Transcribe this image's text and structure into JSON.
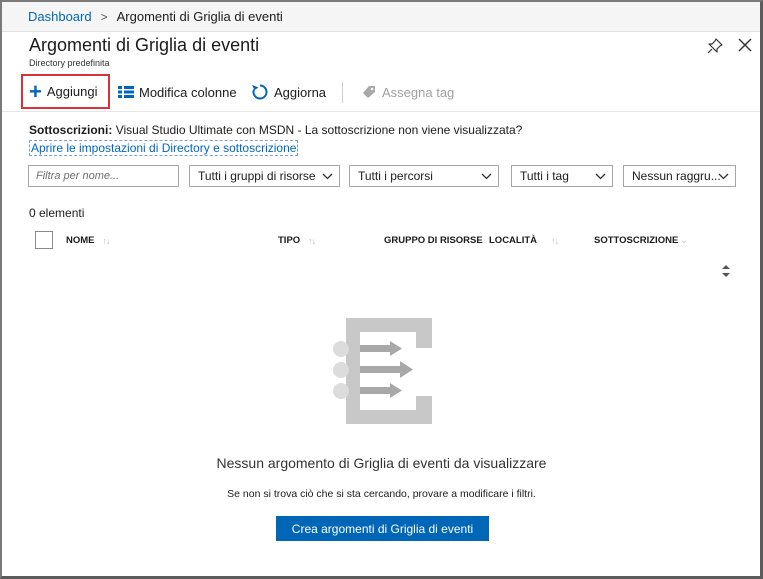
{
  "breadcrumb": {
    "home": "Dashboard",
    "current": "Argomenti di Griglia di eventi"
  },
  "header": {
    "title": "Argomenti di Griglia di eventi",
    "subtitle": "Directory predefinita"
  },
  "toolbar": {
    "add_label": "Aggiungi",
    "edit_columns_label": "Modifica colonne",
    "refresh_label": "Aggiorna",
    "assign_tags_label": "Assegna tag"
  },
  "subscriptions": {
    "label": "Sottoscrizioni:",
    "text": "Visual Studio Ultimate con MSDN - La sottoscrizione non viene visualizzata?",
    "link": "Aprire le impostazioni di Directory e sottoscrizione"
  },
  "filters": {
    "name_placeholder": "Filtra per nome...",
    "resource_groups": "Tutti i gruppi di risorse",
    "locations": "Tutti i percorsi",
    "tags": "Tutti i tag",
    "grouping": "Nessun raggru..."
  },
  "list": {
    "count": "0 elementi",
    "columns": {
      "name": "NOME",
      "type": "TIPO",
      "resource_group": "GRUPPO DI RISORSE",
      "location": "LOCALITÀ",
      "subscription": "SOTTOSCRIZIONE"
    }
  },
  "empty": {
    "message": "Nessun argomento di Griglia di eventi da visualizzare",
    "hint": "Se non si trova ciò che si sta cercando, provare a modificare i filtri.",
    "create_label": "Crea argomenti di Griglia di eventi"
  },
  "colors": {
    "accent": "#0067b8",
    "highlight_border": "#d9333a",
    "graphic_gray": "#c8c8c8"
  },
  "icons": [
    "plus-icon",
    "columns-icon",
    "refresh-icon",
    "tag-icon",
    "pin-icon",
    "close-icon",
    "chevron-down-icon",
    "sort-icon",
    "event-grid-empty-icon"
  ]
}
